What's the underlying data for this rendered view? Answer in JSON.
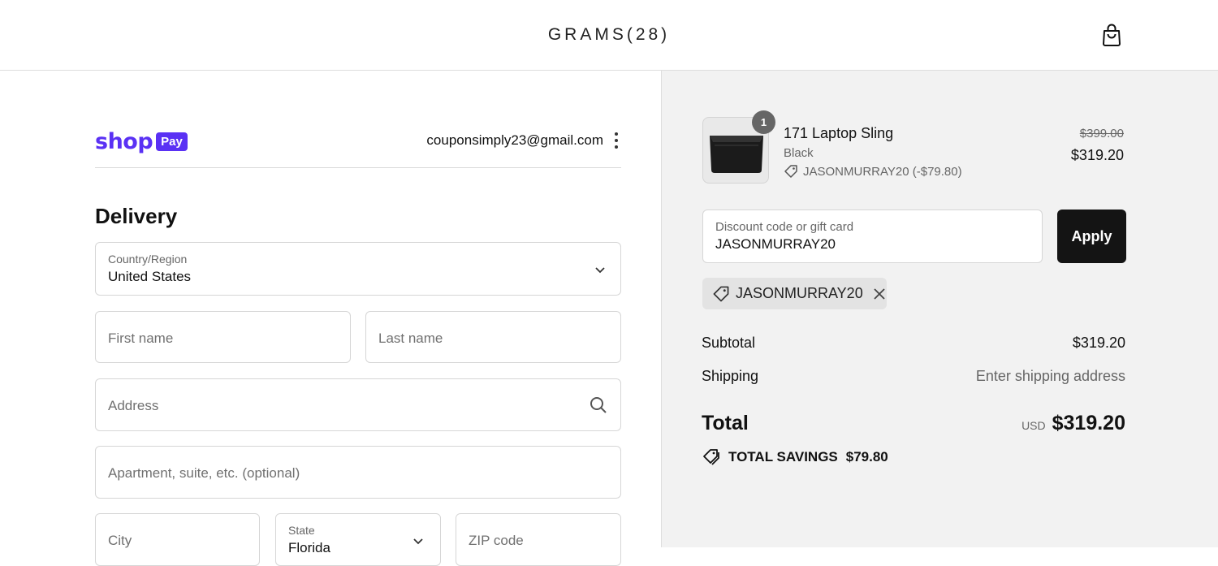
{
  "header": {
    "brand": "GRAMS(28)"
  },
  "shop_pay": {
    "shop_label": "shop",
    "pay_label": "Pay"
  },
  "account": {
    "email": "couponsimply23@gmail.com"
  },
  "delivery": {
    "heading": "Delivery",
    "country_label": "Country/Region",
    "country_value": "United States",
    "first_name_placeholder": "First name",
    "last_name_placeholder": "Last name",
    "address_placeholder": "Address",
    "apartment_placeholder": "Apartment, suite, etc. (optional)",
    "city_placeholder": "City",
    "state_label": "State",
    "state_value": "Florida",
    "zip_placeholder": "ZIP code"
  },
  "order": {
    "item": {
      "quantity": "1",
      "name": "171 Laptop Sling",
      "variant": "Black",
      "discount": "JASONMURRAY20 (-$79.80)",
      "original_price": "$399.00",
      "price": "$319.20"
    },
    "discount_field": {
      "label": "Discount code or gift card",
      "value": "JASONMURRAY20"
    },
    "apply_label": "Apply",
    "applied_code": "JASONMURRAY20",
    "subtotal_label": "Subtotal",
    "subtotal_value": "$319.20",
    "shipping_label": "Shipping",
    "shipping_value": "Enter shipping address",
    "total_label": "Total",
    "currency": "USD",
    "total_value": "$319.20",
    "savings_label": "TOTAL SAVINGS",
    "savings_value": "$79.80"
  },
  "colors": {
    "shop_pay": "#5a31f4",
    "apply_button": "#141414",
    "summary_bg": "#f2f2f2"
  },
  "icons": [
    "shopping-bag-icon",
    "kebab-menu-icon",
    "chevron-down-icon",
    "search-icon",
    "tag-icon",
    "close-icon",
    "tags-icon"
  ]
}
